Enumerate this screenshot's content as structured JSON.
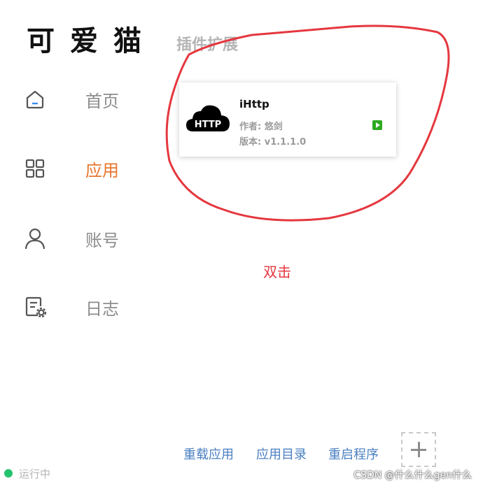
{
  "app": {
    "title": "可爱猫"
  },
  "section": {
    "title": "插件扩展"
  },
  "nav": {
    "items": [
      {
        "label": "首页",
        "icon": "home-icon",
        "active": false
      },
      {
        "label": "应用",
        "icon": "apps-grid-icon",
        "active": true
      },
      {
        "label": "账号",
        "icon": "user-icon",
        "active": false
      },
      {
        "label": "日志",
        "icon": "log-settings-icon",
        "active": false
      }
    ]
  },
  "plugin": {
    "logo_text": "HTTP",
    "name": "iHttp",
    "author": "作者: 悠剑",
    "version": "版本: v1.1.1.0",
    "run_icon": "play-icon"
  },
  "annotation": {
    "text": "双击",
    "color": "#e5373f"
  },
  "bottom_actions": [
    {
      "label": "重载应用"
    },
    {
      "label": "应用目录"
    },
    {
      "label": "重启程序"
    }
  ],
  "status": {
    "text": "运行中",
    "color": "#25c26e"
  },
  "watermark": "CSDN @什么什么gen什么",
  "colors": {
    "accent": "#e8772e",
    "link": "#4a7fc1",
    "muted": "#8c8c8c"
  }
}
